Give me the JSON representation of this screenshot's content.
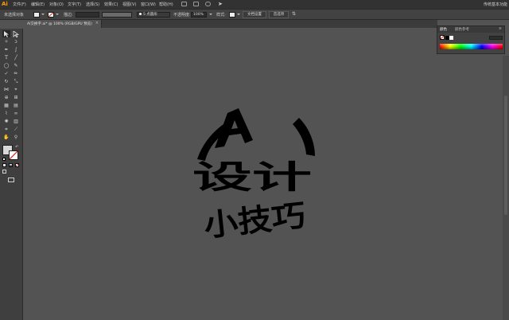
{
  "app": {
    "logo": "Ai"
  },
  "menu": {
    "items": [
      "文件(F)",
      "编辑(E)",
      "对象(O)",
      "文字(T)",
      "选择(S)",
      "效果(C)",
      "视图(V)",
      "窗口(W)",
      "帮助(H)"
    ],
    "workspace_label": "传统基本功能"
  },
  "control_bar": {
    "selection_label": "未选择对象",
    "stroke_label": "描边:",
    "brush_label": "5 点圆形",
    "opacity_label": "不透明度:",
    "opacity_value": "100%",
    "style_label": "样式:",
    "doc_setup_button": "文档设置",
    "preferences_button": "首选项"
  },
  "document_tab": {
    "title": "AI交换字.ai* @ 100% (RGB/GPU 预览)",
    "close": "×"
  },
  "color_panel": {
    "tabs": [
      "颜色",
      "颜色参考"
    ]
  },
  "artwork": {
    "letter": "A",
    "line1": "设计",
    "line2": "小技巧",
    "fill_color": "#000000"
  },
  "colors": {
    "canvas": "#535353",
    "menubar": "#323232",
    "panel": "#424242",
    "accent_logo": "#ff9a00"
  }
}
